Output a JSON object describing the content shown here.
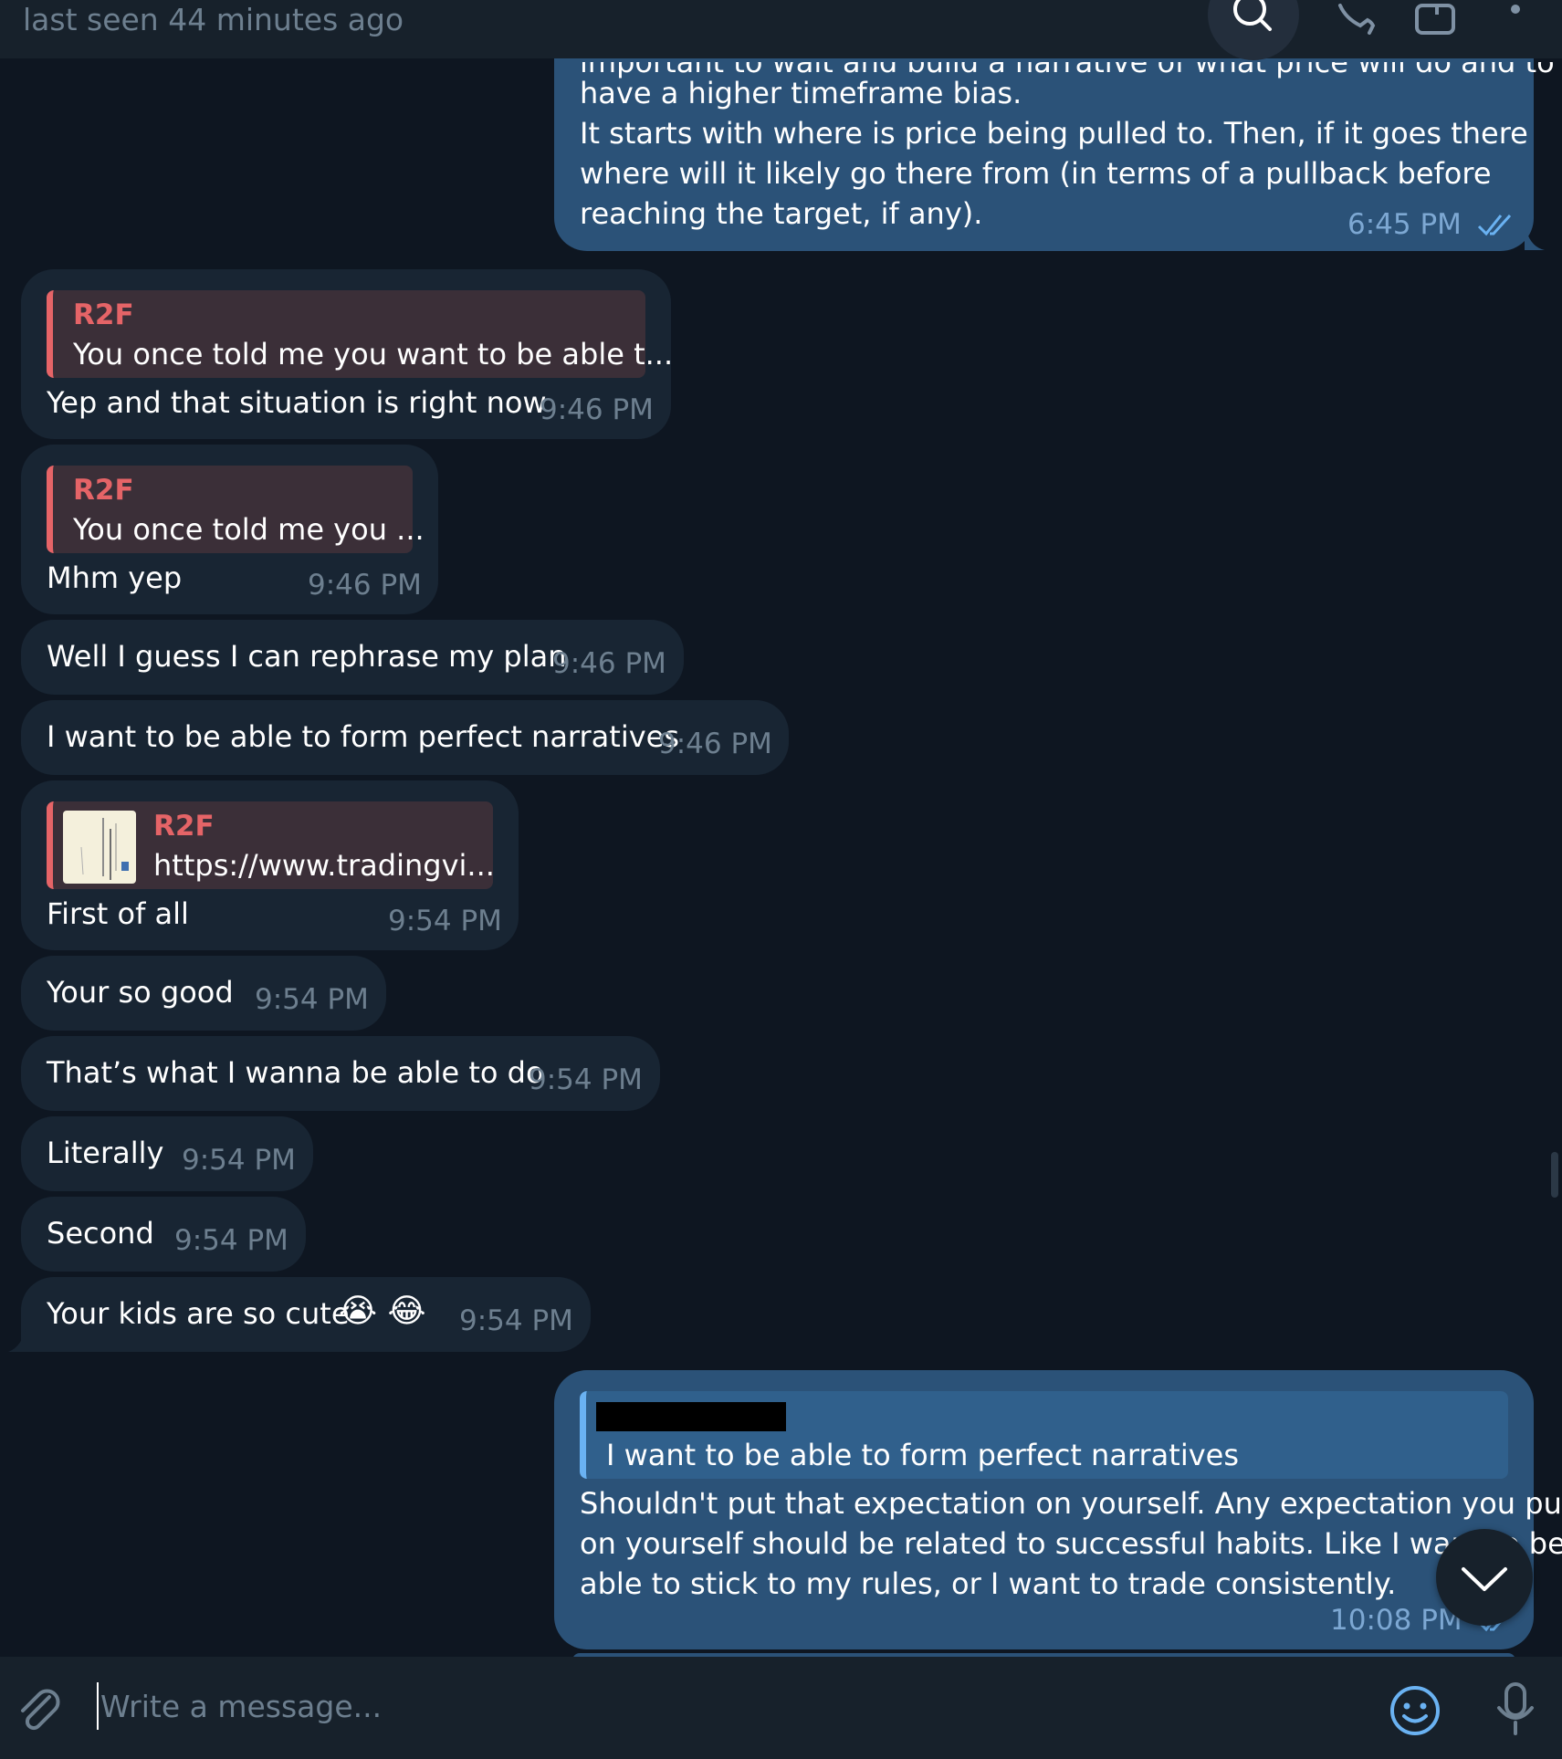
{
  "header": {
    "status": "last seen 44 minutes ago",
    "icons": [
      "search-icon",
      "phone-icon",
      "sidebar-icon",
      "more-icon"
    ]
  },
  "messages": {
    "m0": {
      "text": [
        "have a higher timeframe bias.",
        "It starts with where is price being pulled to. Then, if it goes there",
        "where will it likely go there from (in terms of a pullback before",
        "reaching the target, if any)."
      ],
      "time": "6:45 PM"
    },
    "m1": {
      "reply_name": "R2F",
      "reply_text": "You once told me you want to be able t...",
      "text": "Yep and that situation is right now",
      "time": "9:46 PM"
    },
    "m2": {
      "reply_name": "R2F",
      "reply_text": "You once told me you ...",
      "text": "Mhm yep",
      "time": "9:46 PM"
    },
    "m3": {
      "text": "Well I guess I can rephrase my plan",
      "time": "9:46 PM"
    },
    "m4": {
      "text": "I want to be able to form perfect narratives",
      "time": "9:46 PM"
    },
    "m5": {
      "reply_name": "R2F",
      "reply_text": "https://www.tradingvi...",
      "text": "First of all",
      "time": "9:54 PM"
    },
    "m6": {
      "text": "Your so good",
      "time": "9:54 PM"
    },
    "m7": {
      "text": "That’s what I wanna be able to do",
      "time": "9:54 PM"
    },
    "m8": {
      "text": "Literally",
      "time": "9:54 PM"
    },
    "m9": {
      "text": "Second",
      "time": "9:54 PM"
    },
    "m10": {
      "text": "Your kids are so cute",
      "emoji": "😭 😂",
      "time": "9:54 PM"
    },
    "m11": {
      "reply_text": "I want to be able to form perfect narratives",
      "text": [
        "Shouldn't put that expectation on yourself. Any expectation you put",
        "on yourself should be related to successful habits. Like I want to be",
        "able to stick to my rules, or I want to trade consistently."
      ],
      "time": "10:08 PM"
    }
  },
  "composer": {
    "placeholder": "Write a message..."
  },
  "colors": {
    "background": "#0e1621",
    "incoming": "#182533",
    "outgoing": "#2b5278",
    "reply_accent": "#e56467",
    "link_accent": "#6ab2f2"
  }
}
